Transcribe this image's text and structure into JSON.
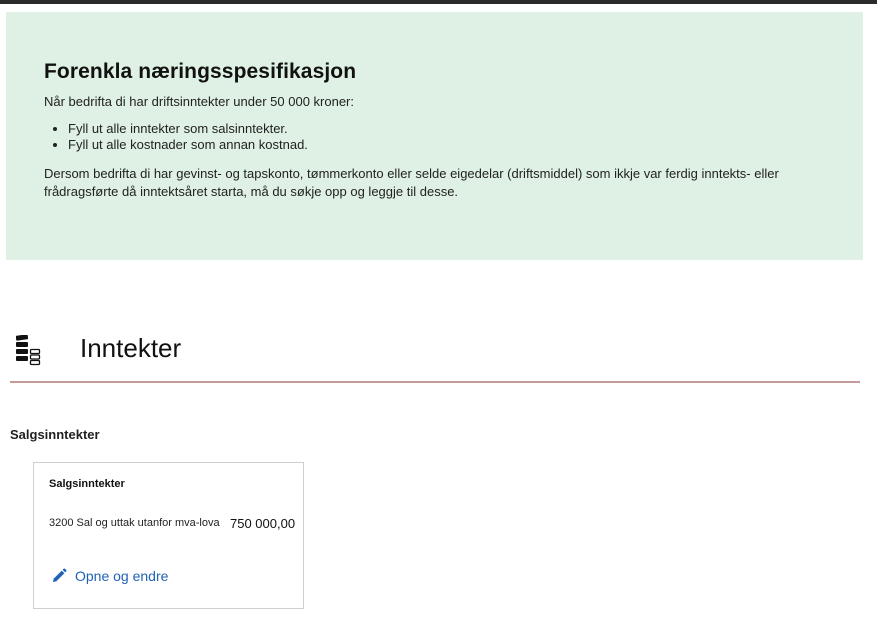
{
  "info": {
    "title": "Forenkla næringsspesifikasjon",
    "intro": "Når bedrifta di har driftsinntekter under 50 000 kroner:",
    "bullets": [
      "Fyll ut alle inntekter som salsinntekter.",
      "Fyll ut alle kostnader som annan kostnad."
    ],
    "body": "Dersom bedrifta di har gevinst- og tapskonto, tømmerkonto eller selde eigedelar (driftsmiddel) som ikkje var ferdig inntekts- eller frådragsførte då inntektsåret starta, må du søkje opp og leggje til desse."
  },
  "section": {
    "title": "Inntekter",
    "icon": "income-stack-icon",
    "subheading": "Salgsinntekter"
  },
  "card": {
    "title": "Salgsinntekter",
    "item_label": "3200 Sal og uttak utanfor mva-lova",
    "item_amount": "750 000,00",
    "link_label": "Opne og endre",
    "link_icon": "pencil-icon"
  },
  "colors": {
    "info_background": "#dff1e5",
    "link": "#2063b5",
    "section_rule": "#c49a9a"
  }
}
